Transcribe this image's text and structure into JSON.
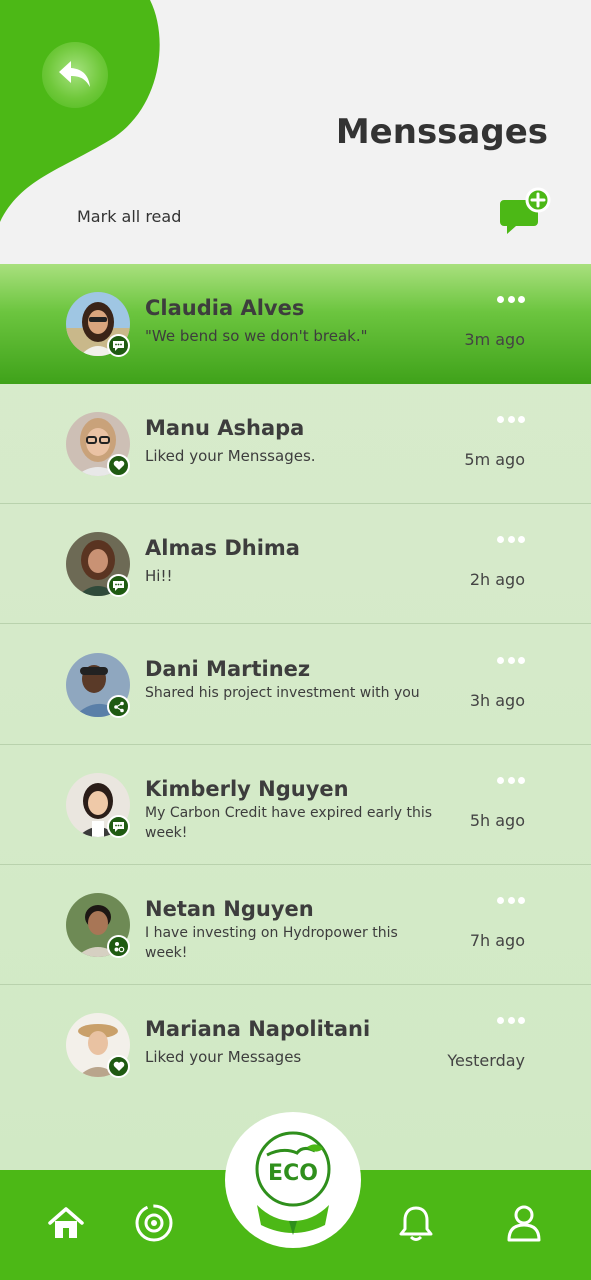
{
  "header": {
    "title": "Menssages",
    "mark_all_read": "Mark all read"
  },
  "colors": {
    "brand_green": "#4cb816",
    "dark_green": "#1f5a12",
    "list_bg": "#d5eac9"
  },
  "messages": [
    {
      "name": "Claudia Alves",
      "text": "\"We bend so we don't break.\"",
      "time": "3m ago",
      "badge_icon": "chat-icon",
      "active": true
    },
    {
      "name": "Manu Ashapa",
      "text": "Liked your Menssages.",
      "time": "5m ago",
      "badge_icon": "heart-icon"
    },
    {
      "name": "Almas Dhima",
      "text": "Hi!!",
      "time": "2h ago",
      "badge_icon": "chat-icon"
    },
    {
      "name": "Dani Martinez",
      "text": "Shared his project investment with you",
      "time": "3h ago",
      "badge_icon": "share-icon"
    },
    {
      "name": "Kimberly Nguyen",
      "text": "My Carbon Credit have expired early this week!",
      "time": "5h ago",
      "badge_icon": "chat-icon"
    },
    {
      "name": "Netan Nguyen",
      "text": "I have investing on Hydropower this week!",
      "time": "7h ago",
      "badge_icon": "invest-icon"
    },
    {
      "name": "Mariana Napolitani",
      "text": "Liked your  Messages",
      "time": "Yesterday",
      "badge_icon": "heart-icon"
    }
  ],
  "bottom_nav": {
    "items": [
      "home-icon",
      "settings-cycle-icon",
      "eco-logo",
      "bell-icon",
      "user-icon"
    ],
    "logo_text": "ECO"
  }
}
